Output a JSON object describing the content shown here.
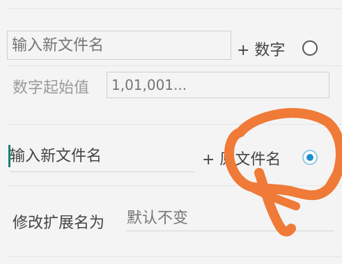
{
  "filename_section": {
    "input_placeholder": "输入新文件名",
    "plus_number_label": "+ 数字",
    "number_radio_checked": false,
    "start_value_label": "数字起始值",
    "start_value_placeholder": "1,01,001..."
  },
  "original_name_section": {
    "input_value": "输入新文件名",
    "plus_original_label": "+ 原文件名",
    "original_radio_checked": true
  },
  "extension_section": {
    "label": "修改扩展名为",
    "placeholder": "默认不变"
  },
  "annotation": {
    "color": "#f07a37",
    "type": "hand-drawn circle"
  }
}
